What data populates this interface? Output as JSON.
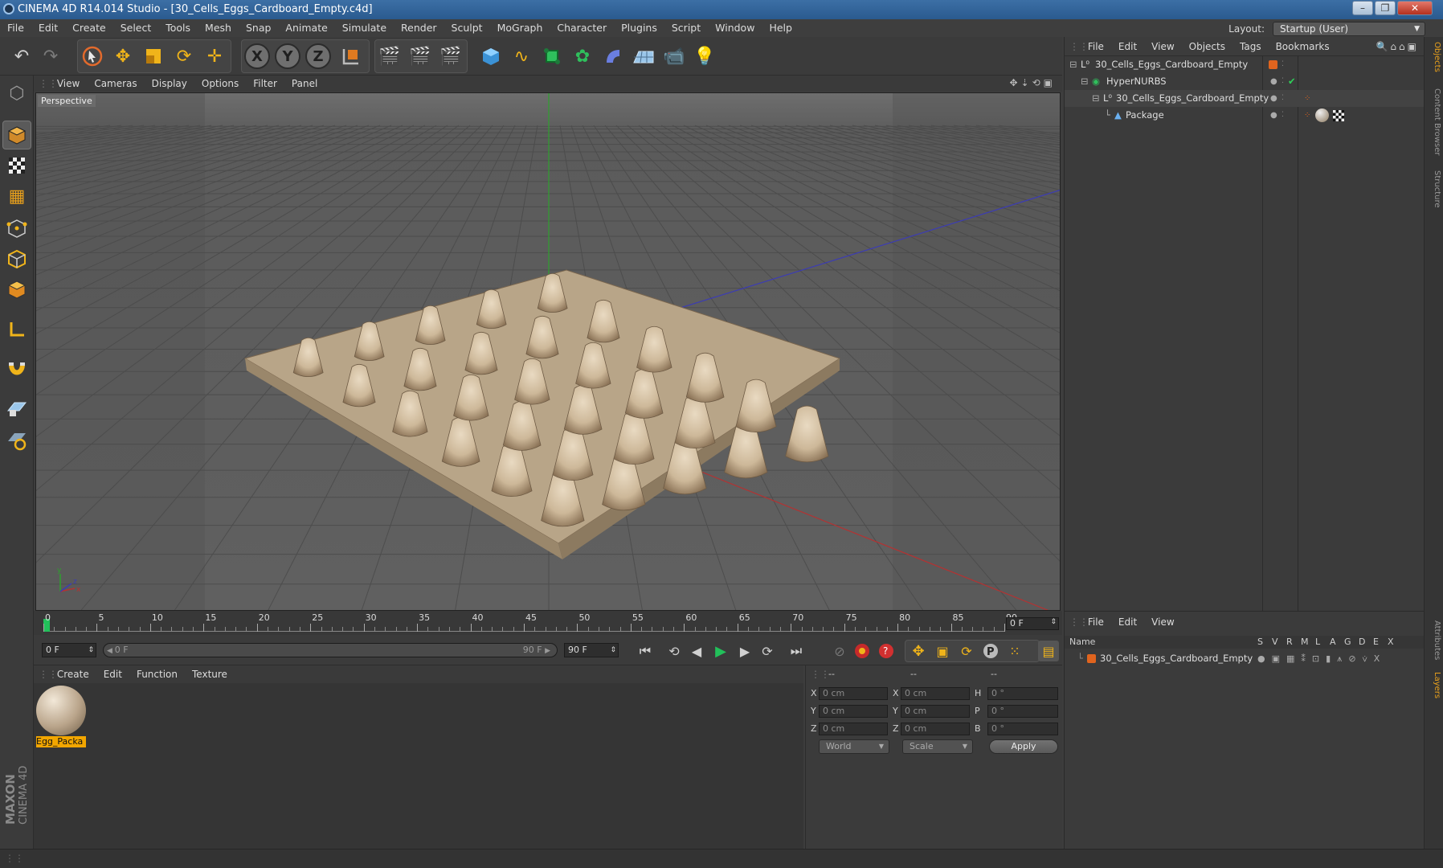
{
  "window": {
    "title": "CINEMA 4D R14.014 Studio - [30_Cells_Eggs_Cardboard_Empty.c4d]"
  },
  "menubar": {
    "items": [
      "File",
      "Edit",
      "Create",
      "Select",
      "Tools",
      "Mesh",
      "Snap",
      "Animate",
      "Simulate",
      "Render",
      "Sculpt",
      "MoGraph",
      "Character",
      "Plugins",
      "Script",
      "Window",
      "Help"
    ],
    "layout_label": "Layout:",
    "layout_value": "Startup (User)"
  },
  "viewport": {
    "menu": [
      "View",
      "Cameras",
      "Display",
      "Options",
      "Filter",
      "Panel"
    ],
    "camera_label": "Perspective"
  },
  "timeline": {
    "ticks": [
      "0",
      "5",
      "10",
      "15",
      "20",
      "25",
      "30",
      "35",
      "40",
      "45",
      "50",
      "55",
      "60",
      "65",
      "70",
      "75",
      "80",
      "85",
      "90"
    ],
    "current_frame": "0 F"
  },
  "transport": {
    "start_field": "0 F",
    "range_start": "0 F",
    "range_end": "90 F",
    "end_field": "90 F"
  },
  "materials": {
    "menu": [
      "Create",
      "Edit",
      "Function",
      "Texture"
    ],
    "items": [
      {
        "name": "Egg_Packa"
      }
    ]
  },
  "coordinates": {
    "headers": [
      "--",
      "--",
      "--"
    ],
    "rows": [
      {
        "a": "X",
        "pos": "0 cm",
        "b": "X",
        "size": "0 cm",
        "c": "H",
        "rot": "0 °"
      },
      {
        "a": "Y",
        "pos": "0 cm",
        "b": "Y",
        "size": "0 cm",
        "c": "P",
        "rot": "0 °"
      },
      {
        "a": "Z",
        "pos": "0 cm",
        "b": "Z",
        "size": "0 cm",
        "c": "B",
        "rot": "0 °"
      }
    ],
    "space": "World",
    "mode": "Scale",
    "apply": "Apply"
  },
  "objects": {
    "menu": [
      "File",
      "Edit",
      "View",
      "Objects",
      "Tags",
      "Bookmarks"
    ],
    "tree": [
      {
        "name": "30_Cells_Eggs_Cardboard_Empty"
      },
      {
        "name": "HyperNURBS"
      },
      {
        "name": "30_Cells_Eggs_Cardboard_Empty"
      },
      {
        "name": "Package"
      }
    ]
  },
  "layers": {
    "menu": [
      "File",
      "Edit",
      "View"
    ],
    "columns": [
      "Name",
      "S",
      "V",
      "R",
      "M",
      "L",
      "A",
      "G",
      "D",
      "E",
      "X"
    ],
    "rows": [
      {
        "name": "30_Cells_Eggs_Cardboard_Empty"
      }
    ]
  },
  "side_tabs": [
    "Objects",
    "Content Browser",
    "Structure",
    "Attributes",
    "Layers"
  ],
  "brand": {
    "line1": "MAXON",
    "line2": "CINEMA 4D"
  },
  "colors": {
    "accent": "#f2a600",
    "layer_color": "#e0641e",
    "grid_y_axis": "#2ea02e",
    "grid_x_axis": "#b43232",
    "grid_z_axis": "#3c3cb4"
  }
}
